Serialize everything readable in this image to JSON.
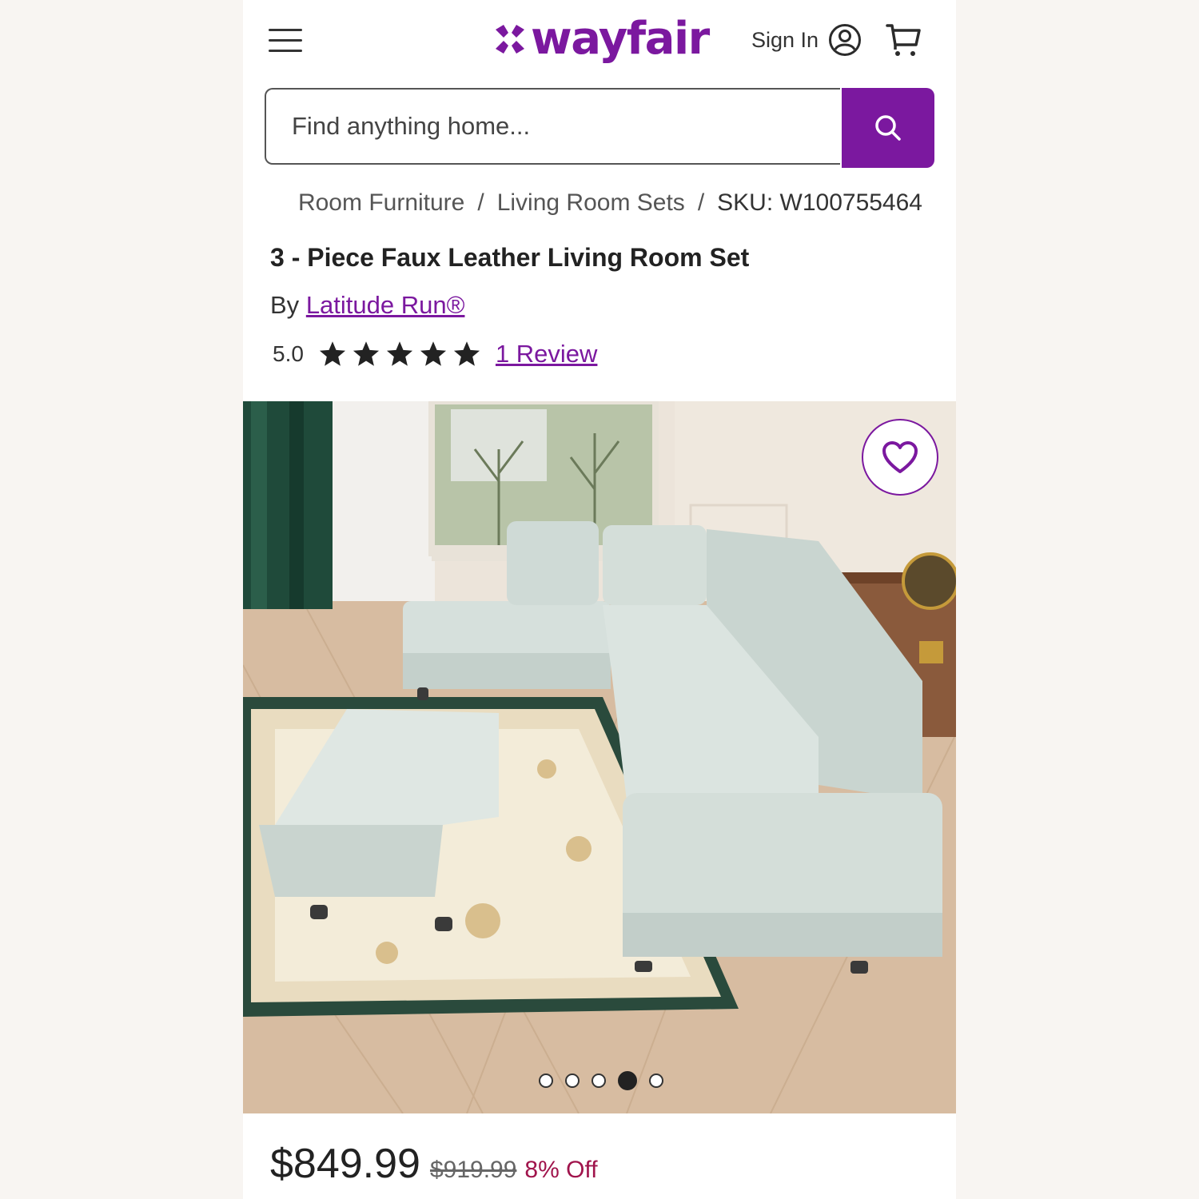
{
  "header": {
    "brand": "wayfair",
    "sign_in_label": "Sign In"
  },
  "search": {
    "placeholder": "Find anything home..."
  },
  "breadcrumb": {
    "items": [
      "Room Furniture",
      "Living Room Sets"
    ],
    "sku": "SKU: W100755464"
  },
  "product": {
    "title": "3 - Piece Faux Leather Living Room Set",
    "by_label": "By",
    "brand": "Latitude Run®",
    "rating": "5.0",
    "stars": 5,
    "review_link": "1 Review"
  },
  "gallery": {
    "image_count": 5,
    "active_index": 4
  },
  "pricing": {
    "price": "$849.99",
    "original_price": "$919.99",
    "discount": "8% Off"
  },
  "colors": {
    "brand": "#7b189f",
    "discount": "#a0144c"
  }
}
